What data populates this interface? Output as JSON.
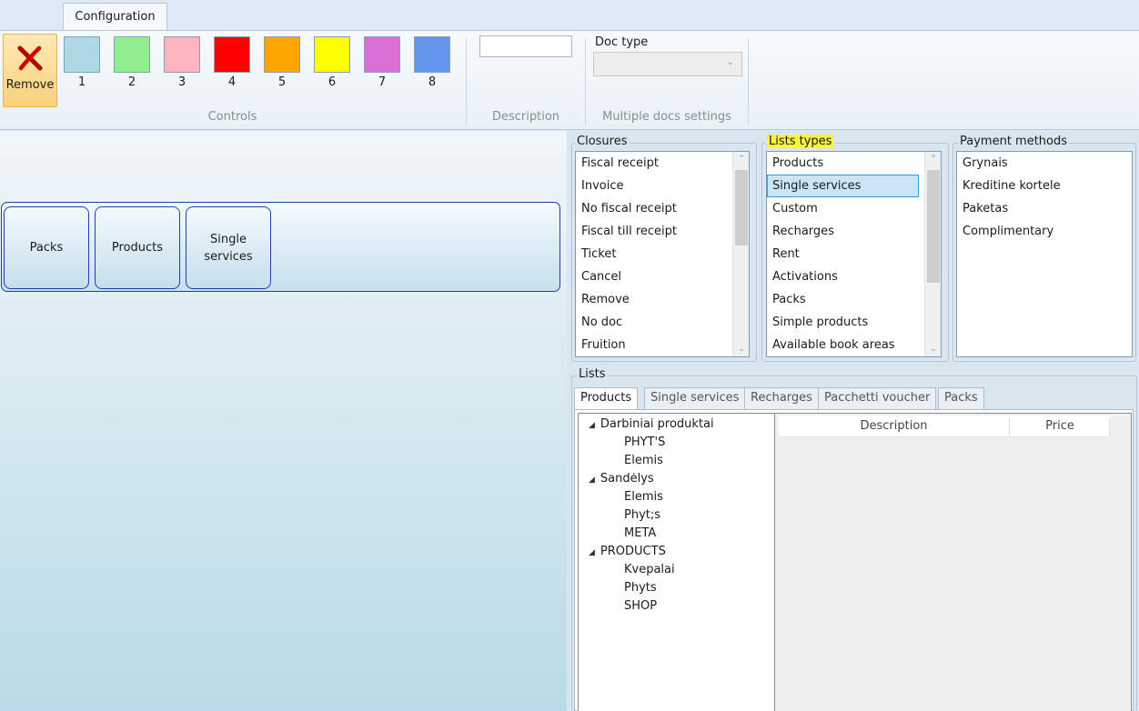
{
  "ribbon": {
    "tab": "Configuration",
    "remove_label": "Remove",
    "swatches": [
      {
        "label": "1",
        "color": "#add8e6"
      },
      {
        "label": "2",
        "color": "#90ee90"
      },
      {
        "label": "3",
        "color": "#ffb6c1"
      },
      {
        "label": "4",
        "color": "#ff0000"
      },
      {
        "label": "5",
        "color": "#ffa500"
      },
      {
        "label": "6",
        "color": "#ffff00"
      },
      {
        "label": "7",
        "color": "#da70d6"
      },
      {
        "label": "8",
        "color": "#6495ed"
      }
    ],
    "group_controls": "Controls",
    "description_value": "",
    "group_description": "Description",
    "doc_type_label": "Doc type",
    "doc_type_value": "",
    "group_multiple_docs": "Multiple docs settings"
  },
  "canvas": {
    "buttons": [
      "Packs",
      "Products",
      "Single services"
    ]
  },
  "closures": {
    "legend": "Closures",
    "items": [
      "Fiscal receipt",
      "Invoice",
      "No fiscal receipt",
      "Fiscal till receipt",
      "Ticket",
      "Cancel",
      "Remove",
      "No doc",
      "Fruition"
    ]
  },
  "lists_types": {
    "legend": "Lists types",
    "items": [
      "Products",
      "Single services",
      "Custom",
      "Recharges",
      "Rent",
      "Activations",
      "Packs",
      "Simple products",
      "Available book areas"
    ],
    "selected": "Single services",
    "highlight_color": "#f9f33b"
  },
  "payment_methods": {
    "legend": "Payment methods",
    "items": [
      "Grynais",
      "Kreditine kortele",
      "Paketas",
      "Complimentary"
    ]
  },
  "lists": {
    "legend": "Lists",
    "tabs": [
      "Products",
      "Single services",
      "Recharges",
      "Pacchetti voucher",
      "Packs"
    ],
    "active_tab": "Products",
    "tree": [
      {
        "label": "Darbiniai produktai",
        "children": [
          "PHYT'S",
          "Elemis"
        ]
      },
      {
        "label": "Sandėlys",
        "children": [
          "Elemis",
          "Phyt;s",
          "META"
        ]
      },
      {
        "label": "PRODUCTS",
        "children": [
          "Kvepalai",
          "Phyts",
          "SHOP"
        ]
      }
    ],
    "grid_columns": [
      "Description",
      "Price"
    ]
  }
}
